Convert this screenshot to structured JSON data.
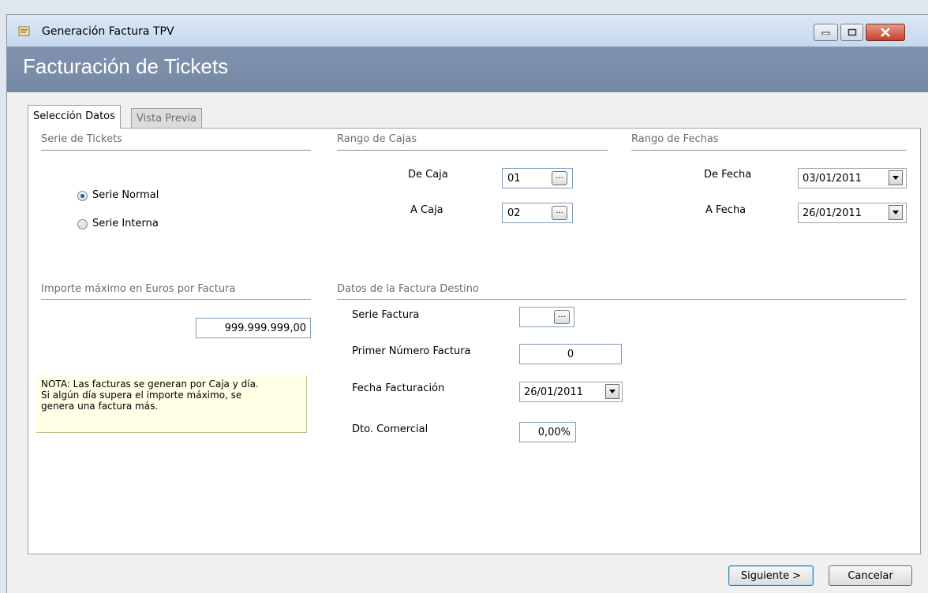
{
  "window": {
    "title": "Generación Factura TPV"
  },
  "banner": {
    "title": "Facturación de Tickets"
  },
  "tabs": [
    {
      "label": "Selección Datos",
      "active": true
    },
    {
      "label": "Vista Previa",
      "active": false
    }
  ],
  "serie_tickets": {
    "label": "Serie de Tickets",
    "options": [
      {
        "label": "Serie Normal",
        "checked": true
      },
      {
        "label": "Serie Interna",
        "checked": false
      }
    ]
  },
  "rango_cajas": {
    "label": "Rango de Cajas",
    "de_label": "De Caja",
    "de_value": "01",
    "a_label": "A Caja",
    "a_value": "02"
  },
  "rango_fechas": {
    "label": "Rango de Fechas",
    "de_label": "De Fecha",
    "de_value": "03/01/2011",
    "a_label": "A Fecha",
    "a_value": "26/01/2011"
  },
  "importe": {
    "label": "Importe máximo en Euros por Factura",
    "value": "999.999.999,00"
  },
  "note": {
    "line1": "NOTA: Las facturas se generan por Caja y día.",
    "line2": "Si algún día supera el importe máximo, se",
    "line3": "genera una factura más."
  },
  "destino": {
    "label": "Datos de la Factura Destino",
    "serie_label": "Serie Factura",
    "serie_value": "",
    "primer_label": "Primer Número Factura",
    "primer_value": "0",
    "fecha_label": "Fecha Facturación",
    "fecha_value": "26/01/2011",
    "dto_label": "Dto. Comercial",
    "dto_value": "0,00%"
  },
  "buttons": {
    "next": "Siguiente >",
    "cancel": "Cancelar"
  },
  "colors": {
    "banner": "#7a8ca8",
    "titlebar": "#d3e1f2",
    "close": "#c94a36"
  }
}
